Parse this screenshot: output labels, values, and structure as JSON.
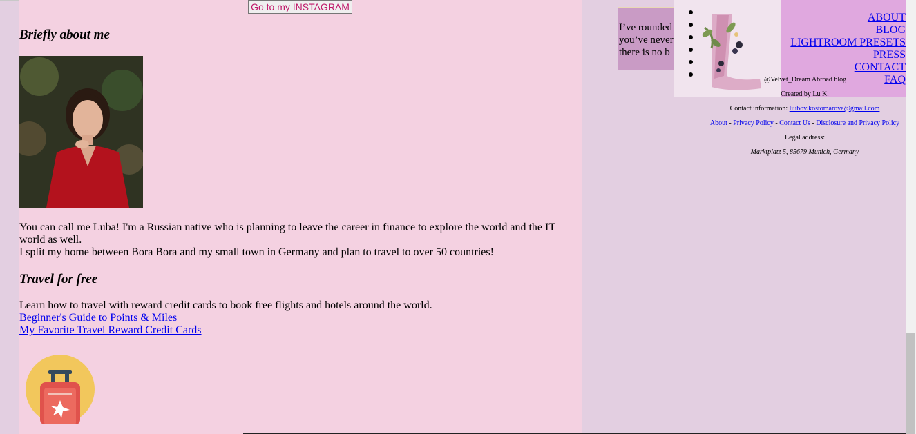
{
  "main": {
    "instagram_button": "Go to my INSTAGRAM",
    "about_heading": "Briefly about me",
    "intro_line_1": "You can call me Luba! I'm a Russian native who is planning to leave the career in finance to explore the world and the IT world as well.",
    "intro_line_2": "I split my home between Bora Bora and my small town in Germany and plan to travel to over 50 countries!",
    "travel_heading": "Travel for free",
    "travel_text": "Learn how to travel with reward credit cards to book free flights and hotels around the world.",
    "links": [
      "Beginner's Guide to Points & Miles",
      "My Favorite Travel Reward Credit Cards"
    ]
  },
  "teaser": {
    "text": "I’ve rounded\nyou’ve never\nthere is no b"
  },
  "header": {
    "blog_handle": "@Velvet_Dream Abroad blog",
    "nav": [
      "ABOUT",
      "BLOG",
      "LIGHTROOM PRESETS",
      "PRESS",
      "CONTACT",
      "FAQ"
    ]
  },
  "footer": {
    "created_by": "Created by Lu K.",
    "contact_label": "Contact information:",
    "contact_email": "liubov.kostomarova@gmail.com",
    "links": [
      "About",
      "Privacy Policy",
      "Contact Us",
      "Disclosure and Privacy Policy"
    ],
    "separator": " - ",
    "legal_label": "Legal address:",
    "legal_address": "Marktplatz 5, 85679 Munich, Germany"
  },
  "colors": {
    "main_bg": "#f4d1e1",
    "page_bg": "#e3cfe1",
    "header_bg": "#e0a8df",
    "teaser_bg": "#c99bc5",
    "link": "#0000ee",
    "instagram_text": "#c0186a"
  }
}
